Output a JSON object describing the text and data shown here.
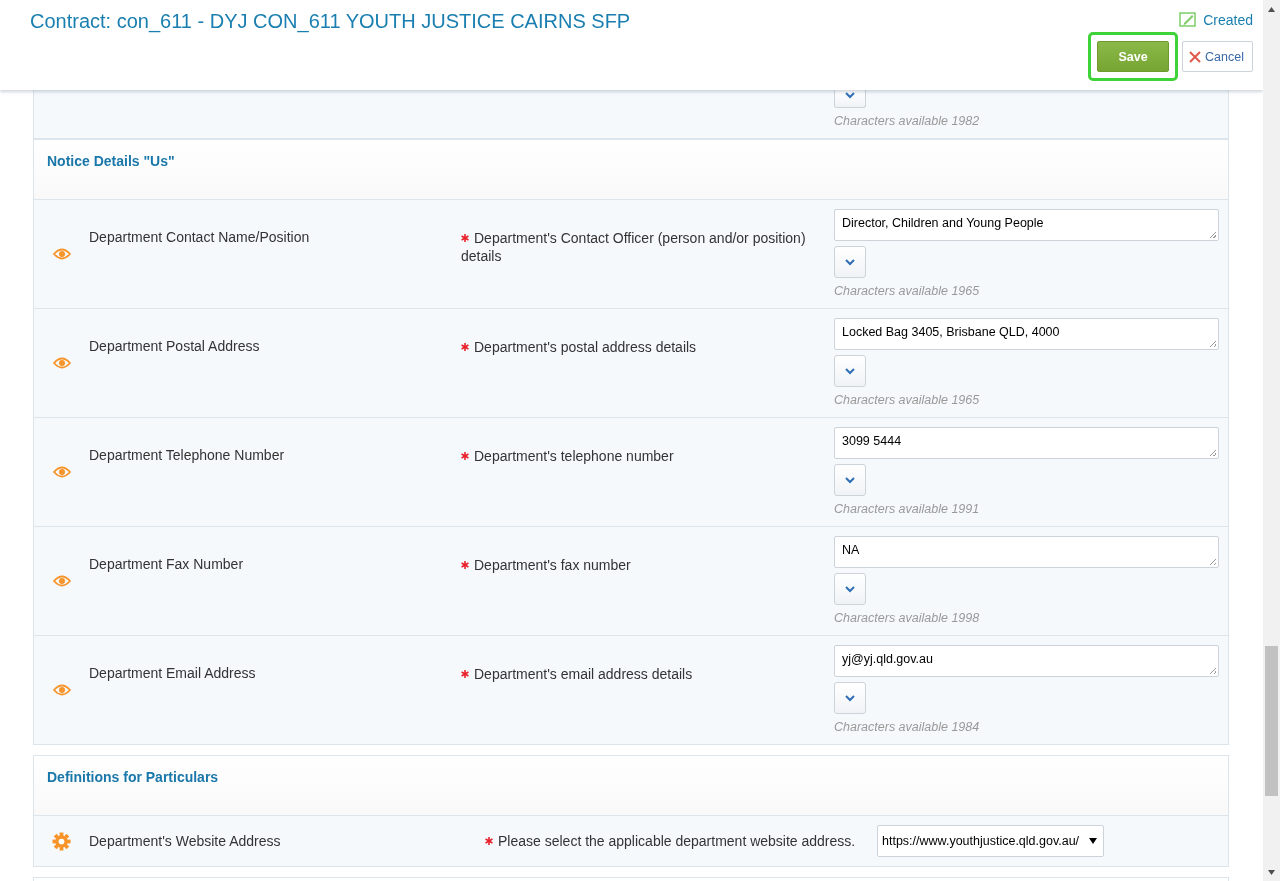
{
  "header": {
    "title": "Contract: con_611 - DYJ CON_611 YOUTH JUSTICE CAIRNS SFP",
    "status": "Created",
    "save": "Save",
    "cancel": "Cancel"
  },
  "partial_row": {
    "chars": "Characters available 1982"
  },
  "sections": [
    {
      "title": "Notice Details \"Us\"",
      "rows": [
        {
          "label": "Department Contact Name/Position",
          "required": true,
          "prompt": "Department's Contact Officer (person and/or position) details",
          "kind": "textarea",
          "value": "Director, Children and Young People",
          "chars": "Characters available 1965"
        },
        {
          "label": "Department Postal Address",
          "required": true,
          "prompt": "Department's postal address details",
          "kind": "textarea",
          "value": "Locked Bag 3405, Brisbane QLD, 4000",
          "chars": "Characters available 1965"
        },
        {
          "label": "Department Telephone Number",
          "required": true,
          "prompt": "Department's telephone number",
          "kind": "textarea",
          "value": "3099 5444",
          "chars": "Characters available 1991"
        },
        {
          "label": "Department Fax Number",
          "required": true,
          "prompt": "Department's fax number",
          "kind": "textarea",
          "value": "NA",
          "chars": "Characters available 1998"
        },
        {
          "label": "Department Email Address",
          "required": true,
          "prompt": "Department's email address details",
          "kind": "textarea",
          "value": "yj@yj.qld.gov.au",
          "chars": "Characters available 1984"
        }
      ]
    },
    {
      "title": "Definitions for Particulars",
      "rows": [
        {
          "label": "Department's Website Address",
          "required": true,
          "prompt": "Please select the applicable department website address.",
          "kind": "select",
          "value": "https://www.youthjustice.qld.gov.au/"
        }
      ]
    }
  ]
}
